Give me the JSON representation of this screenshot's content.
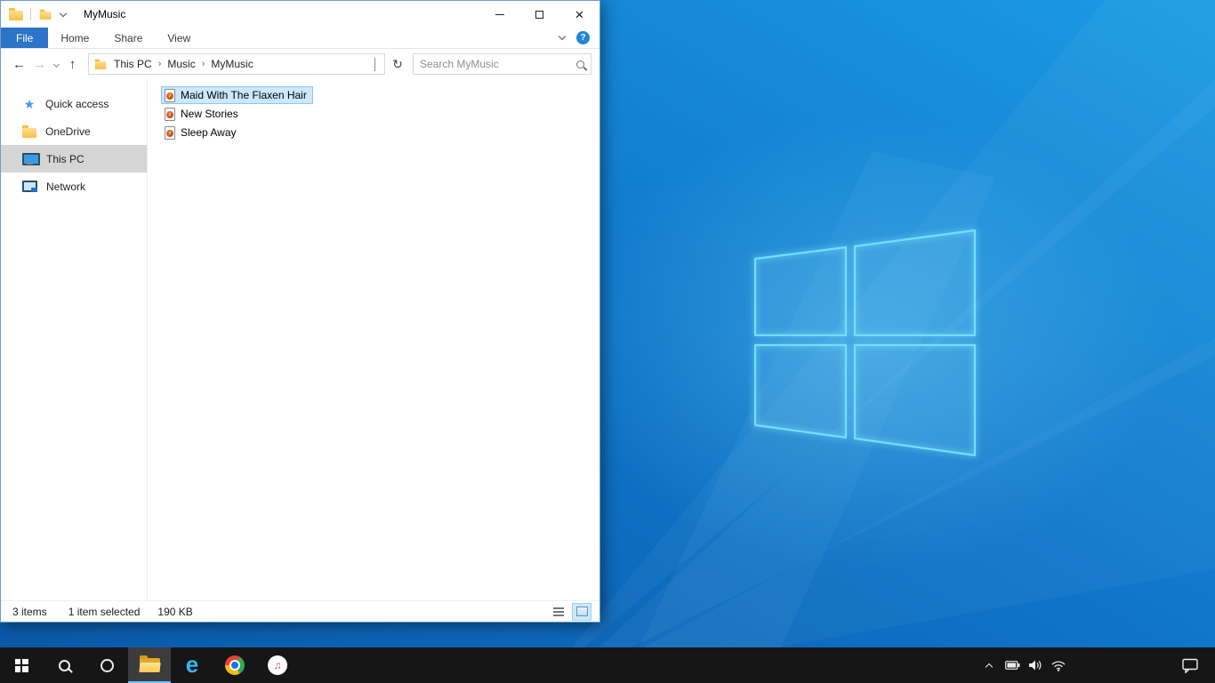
{
  "colors": {
    "accent": "#2b74c8",
    "selection_bg": "#cce8ff",
    "selection_border": "#8ec6f2",
    "taskbar_bg": "#161616",
    "wallpaper_base": "#0d63b6",
    "wallpaper_logo": "#6ee0ff"
  },
  "window": {
    "title": "MyMusic"
  },
  "ribbon": {
    "file_label": "File",
    "tabs": [
      "Home",
      "Share",
      "View"
    ]
  },
  "address": {
    "breadcrumbs": [
      "This PC",
      "Music",
      "MyMusic"
    ],
    "search_placeholder": "Search MyMusic"
  },
  "sidebar": {
    "items": [
      {
        "label": "Quick access",
        "icon": "star-icon",
        "selected": false
      },
      {
        "label": "OneDrive",
        "icon": "folder-icon",
        "selected": false
      },
      {
        "label": "This PC",
        "icon": "monitor-icon",
        "selected": true
      },
      {
        "label": "Network",
        "icon": "network-icon",
        "selected": false
      }
    ]
  },
  "files": [
    {
      "name": "Maid With The Flaxen Hair",
      "icon": "music-file-icon",
      "selected": true
    },
    {
      "name": "New Stories",
      "icon": "music-file-icon",
      "selected": false
    },
    {
      "name": "Sleep Away",
      "icon": "music-file-icon",
      "selected": false
    }
  ],
  "status": {
    "count": "3 items",
    "selected": "1 item selected",
    "size": "190 KB"
  },
  "glyphs": {
    "back": "←",
    "forward": "→",
    "up": "↑",
    "refresh": "↻",
    "crumb_sep": "›",
    "close": "×",
    "help": "?",
    "star": "★",
    "ie": "e",
    "itunes_note": "♫"
  },
  "taskbar": {
    "apps": [
      "start",
      "search",
      "cortana",
      "file-explorer",
      "internet-explorer",
      "chrome",
      "itunes"
    ],
    "active_app": "file-explorer",
    "tray": [
      "hidden-icons",
      "battery",
      "volume",
      "wifi",
      "action-center"
    ]
  }
}
